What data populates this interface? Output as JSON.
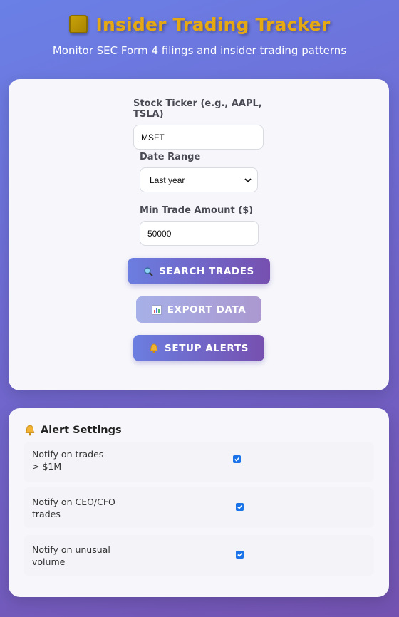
{
  "header": {
    "title": "Insider Trading Tracker",
    "subtitle": "Monitor SEC Form 4 filings and insider trading patterns",
    "icon": "gold-square-icon"
  },
  "search": {
    "ticker_label": "Stock Ticker (e.g., AAPL, TSLA)",
    "ticker_value": "MSFT",
    "date_label": "Date Range",
    "date_value": "Last year",
    "min_label": "Min Trade Amount ($)",
    "min_value": "50000"
  },
  "buttons": {
    "search": "SEARCH TRADES",
    "export": "EXPORT DATA",
    "alerts": "SETUP ALERTS"
  },
  "alerts": {
    "title": "Alert Settings",
    "items": [
      {
        "label_line1": "Notify on trades",
        "label_line2": "> $1M",
        "checked": true
      },
      {
        "label_line1": "Notify on CEO/CFO",
        "label_line2": "trades",
        "checked": true
      },
      {
        "label_line1": "Notify on unusual",
        "label_line2": "volume",
        "checked": true
      }
    ]
  },
  "colors": {
    "accent": "#e6a912",
    "button_gradient_start": "#6b7ee0",
    "button_gradient_end": "#7650b0",
    "checkbox": "#1a73e8"
  }
}
